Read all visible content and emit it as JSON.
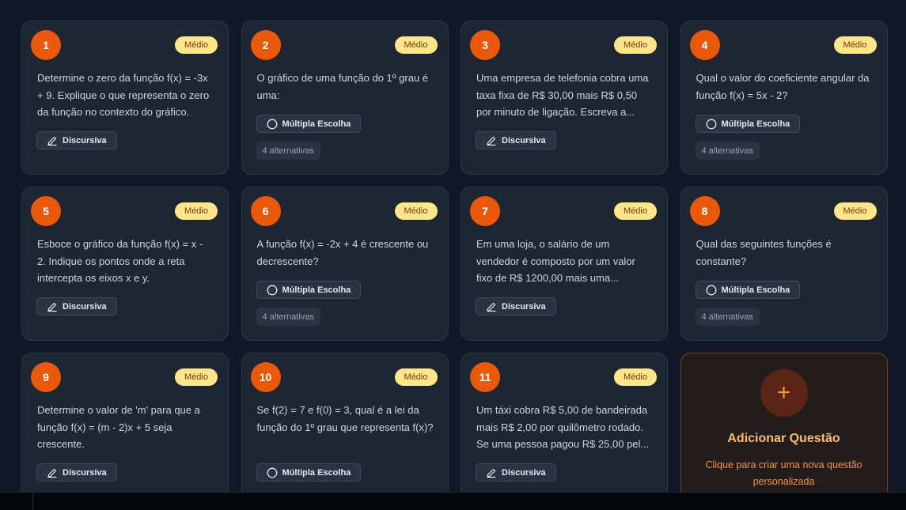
{
  "questions": [
    {
      "number": "1",
      "difficulty": "Médio",
      "text": "Determine o zero da função f(x) = -3x + 9. Explique o que representa o zero da função no contexto do gráfico.",
      "type": "Discursiva"
    },
    {
      "number": "2",
      "difficulty": "Médio",
      "text": "O gráfico de uma função do 1º grau é uma:",
      "type": "Múltipla Escolha",
      "alternatives": "4 alternativas"
    },
    {
      "number": "3",
      "difficulty": "Médio",
      "text": "Uma empresa de telefonia cobra uma taxa fixa de R$ 30,00 mais R$ 0,50 por minuto de ligação. Escreva a...",
      "type": "Discursiva"
    },
    {
      "number": "4",
      "difficulty": "Médio",
      "text": "Qual o valor do coeficiente angular da função f(x) = 5x - 2?",
      "type": "Múltipla Escolha",
      "alternatives": "4 alternativas"
    },
    {
      "number": "5",
      "difficulty": "Médio",
      "text": "Esboce o gráfico da função f(x) = x - 2. Indique os pontos onde a reta intercepta os eixos x e y.",
      "type": "Discursiva"
    },
    {
      "number": "6",
      "difficulty": "Médio",
      "text": "A função f(x) = -2x + 4 é crescente ou decrescente?",
      "type": "Múltipla Escolha",
      "alternatives": "4 alternativas"
    },
    {
      "number": "7",
      "difficulty": "Médio",
      "text": "Em uma loja, o salário de um vendedor é composto por um valor fixo de R$ 1200,00 mais uma...",
      "type": "Discursiva"
    },
    {
      "number": "8",
      "difficulty": "Médio",
      "text": "Qual das seguintes funções é constante?",
      "type": "Múltipla Escolha",
      "alternatives": "4 alternativas"
    },
    {
      "number": "9",
      "difficulty": "Médio",
      "text": "Determine o valor de 'm' para que a função f(x) = (m - 2)x + 5 seja crescente.",
      "type": "Discursiva"
    },
    {
      "number": "10",
      "difficulty": "Médio",
      "text": "Se f(2) = 7 e f(0) = 3, qual é a lei da função do 1º grau que representa f(x)?",
      "type": "Múltipla Escolha",
      "alternatives": ""
    },
    {
      "number": "11",
      "difficulty": "Médio",
      "text": "Um táxi cobra R$ 5,00 de bandeirada mais R$ 2,00 por quilômetro rodado. Se uma pessoa pagou R$ 25,00 pel...",
      "type": "Discursiva"
    }
  ],
  "add_card": {
    "plus": "+",
    "title": "Adicionar Questão",
    "subtitle": "Clique para criar uma nova questão personalizada"
  },
  "colors": {
    "accent": "#ea580c",
    "badge": "#fde68a",
    "background": "#111827",
    "card": "#1e2533"
  }
}
